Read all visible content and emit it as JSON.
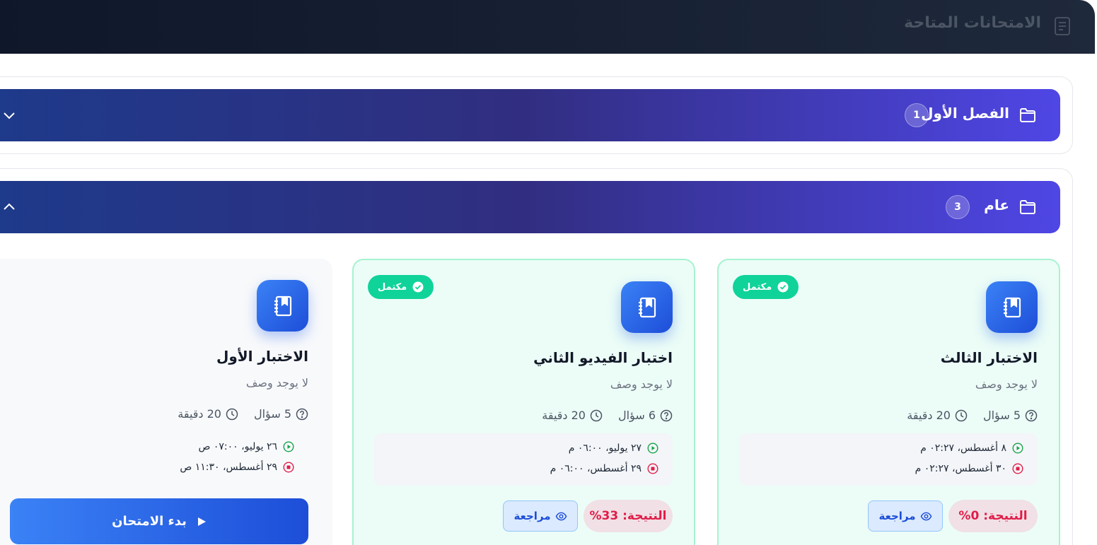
{
  "header": {
    "title": "الامتحانات المتاحة",
    "icon": "document-list-icon"
  },
  "sections": [
    {
      "name": "الفصل الأول",
      "count": "1",
      "state": "collapsed"
    },
    {
      "name": "عام",
      "count": "3",
      "state": "expanded"
    }
  ],
  "exams": [
    {
      "title": "الاختبار الثالث",
      "description": "لا يوجد وصف",
      "questions": "5 سؤال",
      "duration": "20 دقيقة",
      "start": "٨ أغسطس، ٠٢:٢٧ م",
      "end": "٣٠ أغسطس، ٠٢:٢٧ م",
      "status": "مكتمل",
      "score": "النتيجة: 0%",
      "review_label": "مراجعة"
    },
    {
      "title": "اختبار الفيديو الثاني",
      "description": "لا يوجد وصف",
      "questions": "6 سؤال",
      "duration": "20 دقيقة",
      "start": "٢٧ يوليو، ٠٦:٠٠ م",
      "end": "٢٩ أغسطس، ٠٦:٠٠ م",
      "status": "مكتمل",
      "score": "النتيجة: 33%",
      "review_label": "مراجعة"
    },
    {
      "title": "الاختبار الأول",
      "description": "لا يوجد وصف",
      "questions": "5 سؤال",
      "duration": "20 دقيقة",
      "start": "٢٦ يوليو، ٠٧:٠٠ ص",
      "end": "٢٩ أغسطس، ١١:٣٠ ص",
      "start_label": "بدء الامتحان"
    }
  ],
  "colors": {
    "header_bg": "#0f172a",
    "section_gradient_start": "#1e3a8a",
    "section_gradient_end": "#4f46e5",
    "completed_badge": "#10d39a",
    "completed_card_bg": "#ecfdf7",
    "score_text": "#e11d48",
    "primary_button": "#2563eb"
  }
}
